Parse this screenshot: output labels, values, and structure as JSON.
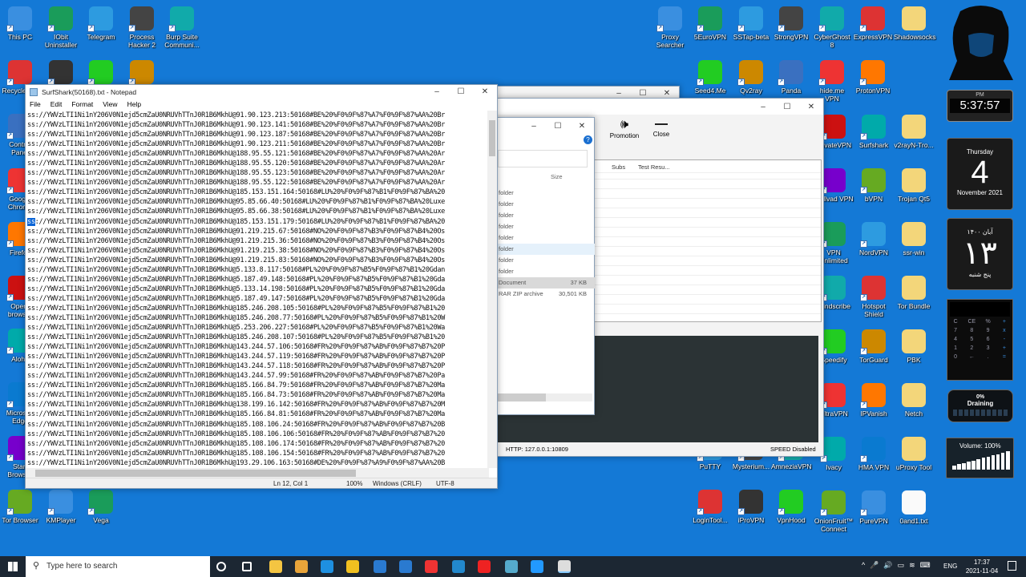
{
  "desktop": {
    "left_icons": [
      "This PC",
      "IObit Uninstaller",
      "Telegram",
      "Process Hacker 2",
      "Burp Suite Communi...",
      "Recycle Bin",
      "",
      "WhatsApp",
      "HxD",
      "Control Panel",
      "Google Chrome",
      "Firefox",
      "Opera browser",
      "Aloha",
      "Microsoft Edge",
      "Start Browser",
      "Tor Browser",
      "KMPlayer",
      "Vega"
    ],
    "right_icons": [
      "Proxy Searcher",
      "5EuroVPN",
      "SSTap-beta",
      "StrongVPN",
      "CyberGhost 8",
      "ExpressVPN",
      "Shadowsocks",
      "Seed4.Me",
      "Qv2ray",
      "Panda",
      "hide.me VPN",
      "ProtonVPN",
      "PrivateVPN",
      "Surfshark",
      "v2rayN-Tro...",
      "Mullvad VPN",
      "bVPN",
      "Trojan Qt5",
      "VPN Unlimited",
      "NordVPN",
      "ssr-win",
      "Windscribe",
      "Hotspot Shield",
      "Tor Bundle",
      "Speedify",
      "TorGuard",
      "PBK",
      "UltraVPN",
      "IPVanish",
      "Netch",
      "Ivacy",
      "HMA VPN",
      "uProxy Tool",
      "OnionFruit™ Connect",
      "PureVPN",
      "0and1.txt",
      "PuTTY",
      "Mysterium...",
      "AmneziaVPN",
      "LoginTool...",
      "iProVPN",
      "VpnHood"
    ]
  },
  "widgets": {
    "clock": {
      "ampm": "PM",
      "time": "5:37:57"
    },
    "calendar": {
      "weekday": "Thursday",
      "day": "4",
      "month_year": "November 2021"
    },
    "persian_calendar": {
      "month_year": "آبان ۱۴۰۰",
      "day": "۱۳",
      "weekday": "پنج شنبه"
    },
    "calculator": {
      "keys": [
        "C",
        "CE",
        "%",
        "+",
        "7",
        "8",
        "9",
        "x",
        "4",
        "5",
        "6",
        "-",
        "1",
        "2",
        "3",
        "+",
        "0",
        "←",
        ".",
        "="
      ]
    },
    "battery": {
      "percent": "0%",
      "status": "Draining"
    },
    "volume": {
      "label": "Volume: 100%",
      "level": 100
    }
  },
  "notepad": {
    "title": "SurfShark(50168).txt - Notepad",
    "menu": [
      "File",
      "Edit",
      "Format",
      "View",
      "Help"
    ],
    "prefix": "ss://YWVzLTI1Ni1nY206V0N1ejd5cmZaU0NRUVhTTnJ0R1B6MkhU@",
    "lines": [
      "91.90.123.213:50168#BE%20%F0%9F%87%A7%F0%9F%87%AA%20Br",
      "91.90.123.141:50168#BE%20%F0%9F%87%A7%F0%9F%87%AA%20Br",
      "91.90.123.187:50168#BE%20%F0%9F%87%A7%F0%9F%87%AA%20Br",
      "91.90.123.211:50168#BE%20%F0%9F%87%A7%F0%9F%87%AA%20Br",
      "188.95.55.121:50168#BE%20%F0%9F%87%A7%F0%9F%87%AA%20Ar",
      "188.95.55.120:50168#BE%20%F0%9F%87%A7%F0%9F%87%AA%20Ar",
      "188.95.55.123:50168#BE%20%F0%9F%87%A7%F0%9F%87%AA%20Ar",
      "188.95.55.122:50168#BE%20%F0%9F%87%A7%F0%9F%87%AA%20Ar",
      "185.153.151.164:50168#LU%20%F0%9F%87%B1%F0%9F%87%BA%20",
      "95.85.66.40:50168#LU%20%F0%9F%87%B1%F0%9F%87%BA%20Luxe",
      "95.85.66.38:50168#LU%20%F0%9F%87%B1%F0%9F%87%BA%20Luxe",
      "185.153.151.179:50168#LU%20%F0%9F%87%B1%F0%9F%87%BA%20",
      "91.219.215.67:50168#NO%20%F0%9F%87%B3%F0%9F%87%B4%20Os",
      "91.219.215.36:50168#NO%20%F0%9F%87%B3%F0%9F%87%B4%20Os",
      "91.219.215.38:50168#NO%20%F0%9F%87%B3%F0%9F%87%B4%20Os",
      "91.219.215.83:50168#NO%20%F0%9F%87%B3%F0%9F%87%B4%20Os",
      "5.133.8.117:50168#PL%20%F0%9F%87%B5%F0%9F%87%B1%20Gdan",
      "5.187.49.148:50168#PL%20%F0%9F%87%B5%F0%9F%87%B1%20Gda",
      "5.133.14.198:50168#PL%20%F0%9F%87%B5%F0%9F%87%B1%20Gda",
      "5.187.49.147:50168#PL%20%F0%9F%87%B5%F0%9F%87%B1%20Gda",
      "185.246.208.105:50168#PL%20%F0%9F%87%B5%F0%9F%87%B1%20",
      "185.246.208.77:50168#PL%20%F0%9F%87%B5%F0%9F%87%B1%20W",
      "5.253.206.227:50168#PL%20%F0%9F%87%B5%F0%9F%87%B1%20Wa",
      "185.246.208.107:50168#PL%20%F0%9F%87%B5%F0%9F%87%B1%20",
      "143.244.57.106:50168#FR%20%F0%9F%87%AB%F0%9F%87%B7%20P",
      "143.244.57.119:50168#FR%20%F0%9F%87%AB%F0%9F%87%B7%20P",
      "143.244.57.118:50168#FR%20%F0%9F%87%AB%F0%9F%87%B7%20P",
      "143.244.57.99:50168#FR%20%F0%9F%87%AB%F0%9F%87%B7%20Pa",
      "185.166.84.79:50168#FR%20%F0%9F%87%AB%F0%9F%87%B7%20Ma",
      "185.166.84.73:50168#FR%20%F0%9F%87%AB%F0%9F%87%B7%20Ma",
      "138.199.16.142:50168#FR%20%F0%9F%87%AB%F0%9F%87%B7%20M",
      "185.166.84.81:50168#FR%20%F0%9F%87%AB%F0%9F%87%B7%20Ma",
      "185.108.106.24:50168#FR%20%F0%9F%87%AB%F0%9F%87%B7%20B",
      "185.108.106.106:50168#FR%20%F0%9F%87%AB%F0%9F%87%B7%20",
      "185.108.106.174:50168#FR%20%F0%9F%87%AB%F0%9F%87%B7%20",
      "185.108.106.154:50168#FR%20%F0%9F%87%AB%F0%9F%87%B7%20",
      "193.29.106.163:50168#DE%20%F0%9F%87%A9%F0%9F%87%AA%20B"
    ],
    "selected_line": 11,
    "status": {
      "position": "Ln 12, Col 1",
      "zoom": "100%",
      "line_ending": "Windows (CRLF)",
      "encoding": "UTF-8"
    }
  },
  "v2rayn": {
    "toolbar": {
      "promotion": "Promotion",
      "close": "Close"
    },
    "columns": [
      "Subs",
      "Test Resu..."
    ],
    "status": {
      "http": "HTTP:  127.0.0.1:10809",
      "speed": "SPEED Disabled"
    }
  },
  "explorer": {
    "size_header": "Size",
    "rows": [
      {
        "type": "folder",
        "size": ""
      },
      {
        "type": "folder",
        "size": ""
      },
      {
        "type": "folder",
        "size": ""
      },
      {
        "type": "folder",
        "size": ""
      },
      {
        "type": "folder",
        "size": ""
      },
      {
        "type": "folder",
        "size": ""
      },
      {
        "type": "folder",
        "size": ""
      },
      {
        "type": "folder",
        "size": ""
      },
      {
        "type": "Document",
        "size": "37 KB"
      },
      {
        "type": "RAR ZIP archive",
        "size": "30,501 KB"
      }
    ]
  },
  "taskbar": {
    "search_placeholder": "Type here to search",
    "language": "ENG",
    "time": "17:37",
    "date": "2021-11-04"
  }
}
